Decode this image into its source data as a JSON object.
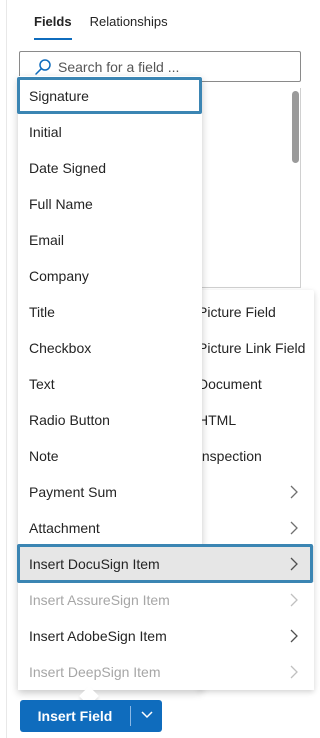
{
  "tabs": {
    "fields": "Fields",
    "relationships": "Relationships"
  },
  "search": {
    "placeholder": "Search for a field ..."
  },
  "background_items": [
    {
      "label": "Picture Field"
    },
    {
      "label": "Picture Link Field"
    },
    {
      "label": "Document"
    },
    {
      "label": "HTML"
    },
    {
      "label": "Inspection"
    }
  ],
  "menu": {
    "items": [
      {
        "label": "Signature"
      },
      {
        "label": "Initial"
      },
      {
        "label": "Date Signed"
      },
      {
        "label": "Full Name"
      },
      {
        "label": "Email"
      },
      {
        "label": "Company"
      },
      {
        "label": "Title"
      },
      {
        "label": "Checkbox"
      },
      {
        "label": "Text"
      },
      {
        "label": "Radio Button"
      },
      {
        "label": "Note"
      },
      {
        "label": "Payment Sum"
      },
      {
        "label": "Attachment"
      }
    ],
    "submenus": [
      {
        "label": "Insert DocuSign Item",
        "enabled": true
      },
      {
        "label": "Insert AssureSign Item",
        "enabled": false
      },
      {
        "label": "Insert AdobeSign Item",
        "enabled": true
      },
      {
        "label": "Insert DeepSign Item",
        "enabled": false
      }
    ]
  },
  "insert_button": {
    "label": "Insert Field"
  },
  "colors": {
    "accent": "#0f6cbd",
    "highlight_border": "#3b85b3",
    "disabled_text": "#a6a6a6"
  }
}
